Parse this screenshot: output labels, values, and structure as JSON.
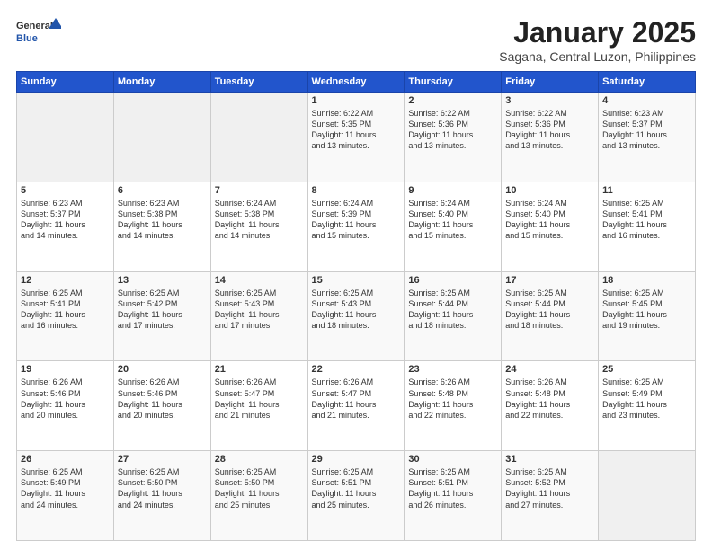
{
  "logo": {
    "general": "General",
    "blue": "Blue"
  },
  "header": {
    "month": "January 2025",
    "location": "Sagana, Central Luzon, Philippines"
  },
  "weekdays": [
    "Sunday",
    "Monday",
    "Tuesday",
    "Wednesday",
    "Thursday",
    "Friday",
    "Saturday"
  ],
  "weeks": [
    [
      {
        "day": "",
        "text": ""
      },
      {
        "day": "",
        "text": ""
      },
      {
        "day": "",
        "text": ""
      },
      {
        "day": "1",
        "text": "Sunrise: 6:22 AM\nSunset: 5:35 PM\nDaylight: 11 hours\nand 13 minutes."
      },
      {
        "day": "2",
        "text": "Sunrise: 6:22 AM\nSunset: 5:36 PM\nDaylight: 11 hours\nand 13 minutes."
      },
      {
        "day": "3",
        "text": "Sunrise: 6:22 AM\nSunset: 5:36 PM\nDaylight: 11 hours\nand 13 minutes."
      },
      {
        "day": "4",
        "text": "Sunrise: 6:23 AM\nSunset: 5:37 PM\nDaylight: 11 hours\nand 13 minutes."
      }
    ],
    [
      {
        "day": "5",
        "text": "Sunrise: 6:23 AM\nSunset: 5:37 PM\nDaylight: 11 hours\nand 14 minutes."
      },
      {
        "day": "6",
        "text": "Sunrise: 6:23 AM\nSunset: 5:38 PM\nDaylight: 11 hours\nand 14 minutes."
      },
      {
        "day": "7",
        "text": "Sunrise: 6:24 AM\nSunset: 5:38 PM\nDaylight: 11 hours\nand 14 minutes."
      },
      {
        "day": "8",
        "text": "Sunrise: 6:24 AM\nSunset: 5:39 PM\nDaylight: 11 hours\nand 15 minutes."
      },
      {
        "day": "9",
        "text": "Sunrise: 6:24 AM\nSunset: 5:40 PM\nDaylight: 11 hours\nand 15 minutes."
      },
      {
        "day": "10",
        "text": "Sunrise: 6:24 AM\nSunset: 5:40 PM\nDaylight: 11 hours\nand 15 minutes."
      },
      {
        "day": "11",
        "text": "Sunrise: 6:25 AM\nSunset: 5:41 PM\nDaylight: 11 hours\nand 16 minutes."
      }
    ],
    [
      {
        "day": "12",
        "text": "Sunrise: 6:25 AM\nSunset: 5:41 PM\nDaylight: 11 hours\nand 16 minutes."
      },
      {
        "day": "13",
        "text": "Sunrise: 6:25 AM\nSunset: 5:42 PM\nDaylight: 11 hours\nand 17 minutes."
      },
      {
        "day": "14",
        "text": "Sunrise: 6:25 AM\nSunset: 5:43 PM\nDaylight: 11 hours\nand 17 minutes."
      },
      {
        "day": "15",
        "text": "Sunrise: 6:25 AM\nSunset: 5:43 PM\nDaylight: 11 hours\nand 18 minutes."
      },
      {
        "day": "16",
        "text": "Sunrise: 6:25 AM\nSunset: 5:44 PM\nDaylight: 11 hours\nand 18 minutes."
      },
      {
        "day": "17",
        "text": "Sunrise: 6:25 AM\nSunset: 5:44 PM\nDaylight: 11 hours\nand 18 minutes."
      },
      {
        "day": "18",
        "text": "Sunrise: 6:25 AM\nSunset: 5:45 PM\nDaylight: 11 hours\nand 19 minutes."
      }
    ],
    [
      {
        "day": "19",
        "text": "Sunrise: 6:26 AM\nSunset: 5:46 PM\nDaylight: 11 hours\nand 20 minutes."
      },
      {
        "day": "20",
        "text": "Sunrise: 6:26 AM\nSunset: 5:46 PM\nDaylight: 11 hours\nand 20 minutes."
      },
      {
        "day": "21",
        "text": "Sunrise: 6:26 AM\nSunset: 5:47 PM\nDaylight: 11 hours\nand 21 minutes."
      },
      {
        "day": "22",
        "text": "Sunrise: 6:26 AM\nSunset: 5:47 PM\nDaylight: 11 hours\nand 21 minutes."
      },
      {
        "day": "23",
        "text": "Sunrise: 6:26 AM\nSunset: 5:48 PM\nDaylight: 11 hours\nand 22 minutes."
      },
      {
        "day": "24",
        "text": "Sunrise: 6:26 AM\nSunset: 5:48 PM\nDaylight: 11 hours\nand 22 minutes."
      },
      {
        "day": "25",
        "text": "Sunrise: 6:25 AM\nSunset: 5:49 PM\nDaylight: 11 hours\nand 23 minutes."
      }
    ],
    [
      {
        "day": "26",
        "text": "Sunrise: 6:25 AM\nSunset: 5:49 PM\nDaylight: 11 hours\nand 24 minutes."
      },
      {
        "day": "27",
        "text": "Sunrise: 6:25 AM\nSunset: 5:50 PM\nDaylight: 11 hours\nand 24 minutes."
      },
      {
        "day": "28",
        "text": "Sunrise: 6:25 AM\nSunset: 5:50 PM\nDaylight: 11 hours\nand 25 minutes."
      },
      {
        "day": "29",
        "text": "Sunrise: 6:25 AM\nSunset: 5:51 PM\nDaylight: 11 hours\nand 25 minutes."
      },
      {
        "day": "30",
        "text": "Sunrise: 6:25 AM\nSunset: 5:51 PM\nDaylight: 11 hours\nand 26 minutes."
      },
      {
        "day": "31",
        "text": "Sunrise: 6:25 AM\nSunset: 5:52 PM\nDaylight: 11 hours\nand 27 minutes."
      },
      {
        "day": "",
        "text": ""
      }
    ]
  ]
}
